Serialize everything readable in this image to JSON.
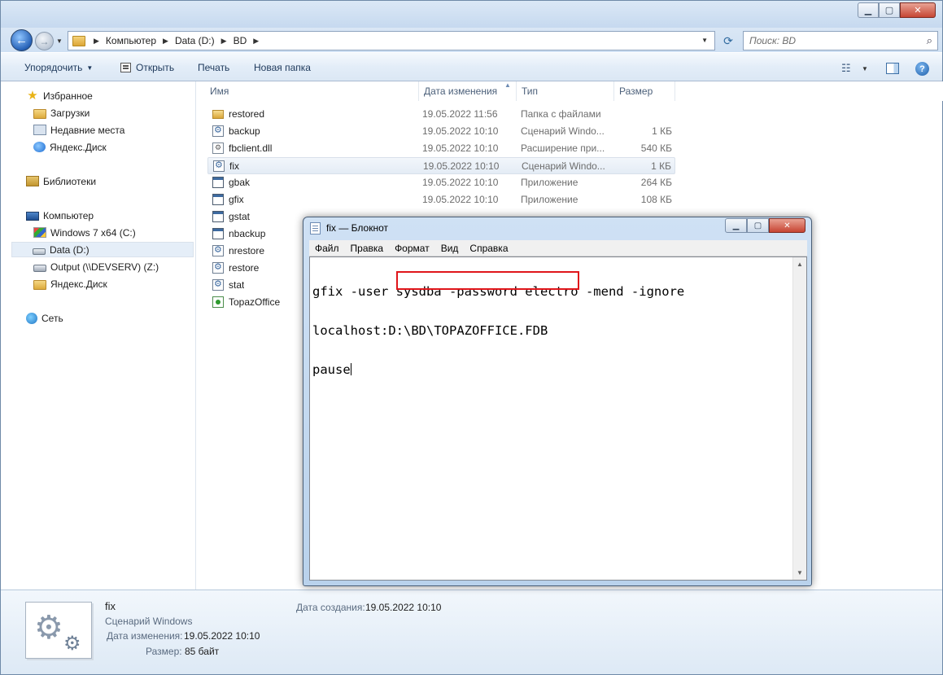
{
  "explorer": {
    "breadcrumb": [
      "Компьютер",
      "Data (D:)",
      "BD"
    ],
    "search_placeholder": "Поиск: BD",
    "toolbar": {
      "organize": "Упорядочить",
      "open": "Открыть",
      "print": "Печать",
      "new_folder": "Новая папка"
    },
    "nav": {
      "favorites": "Избранное",
      "downloads": "Загрузки",
      "recent": "Недавние места",
      "yadisk1": "Яндекс.Диск",
      "libraries": "Библиотеки",
      "computer": "Компьютер",
      "drive_c": "Windows 7 x64 (C:)",
      "drive_d": "Data (D:)",
      "drive_z": "Output (\\\\DEVSERV) (Z:)",
      "yadisk2": "Яндекс.Диск",
      "network": "Сеть"
    },
    "columns": {
      "name": "Имя",
      "date": "Дата изменения",
      "type": "Тип",
      "size": "Размер"
    },
    "files": [
      {
        "name": "restored",
        "date": "19.05.2022 11:56",
        "type": "Папка с файлами",
        "size": "",
        "icon": "folder-icon"
      },
      {
        "name": "backup",
        "date": "19.05.2022 10:10",
        "type": "Сценарий Windo...",
        "size": "1 КБ",
        "icon": "script-icon"
      },
      {
        "name": "fbclient.dll",
        "date": "19.05.2022 10:10",
        "type": "Расширение при...",
        "size": "540 КБ",
        "icon": "dll-icon"
      },
      {
        "name": "fix",
        "date": "19.05.2022 10:10",
        "type": "Сценарий Windo...",
        "size": "1 КБ",
        "icon": "script-icon"
      },
      {
        "name": "gbak",
        "date": "19.05.2022 10:10",
        "type": "Приложение",
        "size": "264 КБ",
        "icon": "app-icon"
      },
      {
        "name": "gfix",
        "date": "19.05.2022 10:10",
        "type": "Приложение",
        "size": "108 КБ",
        "icon": "app-icon"
      },
      {
        "name": "gstat",
        "date": "",
        "type": "",
        "size": "",
        "icon": "app-icon"
      },
      {
        "name": "nbackup",
        "date": "",
        "type": "",
        "size": "",
        "icon": "app-icon"
      },
      {
        "name": "nrestore",
        "date": "",
        "type": "",
        "size": "",
        "icon": "script-icon"
      },
      {
        "name": "restore",
        "date": "",
        "type": "",
        "size": "",
        "icon": "script-icon"
      },
      {
        "name": "stat",
        "date": "",
        "type": "",
        "size": "",
        "icon": "script-icon"
      },
      {
        "name": "TopazOffice",
        "date": "",
        "type": "",
        "size": "",
        "icon": "topaz-app-icon"
      }
    ],
    "details": {
      "name": "fix",
      "type": "Сценарий Windows",
      "modified_label": "Дата изменения:",
      "modified_value": "19.05.2022 10:10",
      "size_label": "Размер:",
      "size_value": "85 байт",
      "created_label": "Дата создания:",
      "created_value": "19.05.2022 10:10"
    }
  },
  "notepad": {
    "title": "fix — Блокнот",
    "menu": [
      "Файл",
      "Правка",
      "Формат",
      "Вид",
      "Справка"
    ],
    "lines": {
      "line1": "gfix -user sysdba -password electro -mend -ignore",
      "line2_prefix": "localhost:",
      "line2_path": "D:\\BD\\TOPAZOFFICE.FDB",
      "line3": "pause"
    },
    "highlight_color": "#e0161b"
  }
}
